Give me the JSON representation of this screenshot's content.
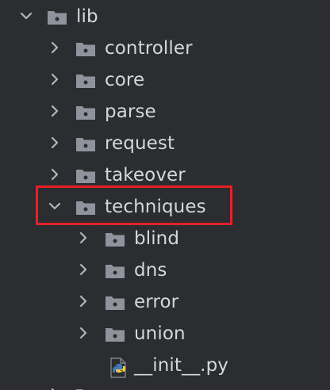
{
  "tree": {
    "root": {
      "label": "lib"
    },
    "children": [
      {
        "label": "controller"
      },
      {
        "label": "core"
      },
      {
        "label": "parse"
      },
      {
        "label": "request"
      },
      {
        "label": "takeover"
      },
      {
        "label": "techniques"
      }
    ],
    "techniques_children": [
      {
        "label": "blind"
      },
      {
        "label": "dns"
      },
      {
        "label": "error"
      },
      {
        "label": "union"
      }
    ],
    "file": {
      "label": "__init__.py"
    },
    "highlight_color": "#e62228",
    "folder_color": "#8f949c",
    "chevron_color": "#b2b5bb"
  }
}
